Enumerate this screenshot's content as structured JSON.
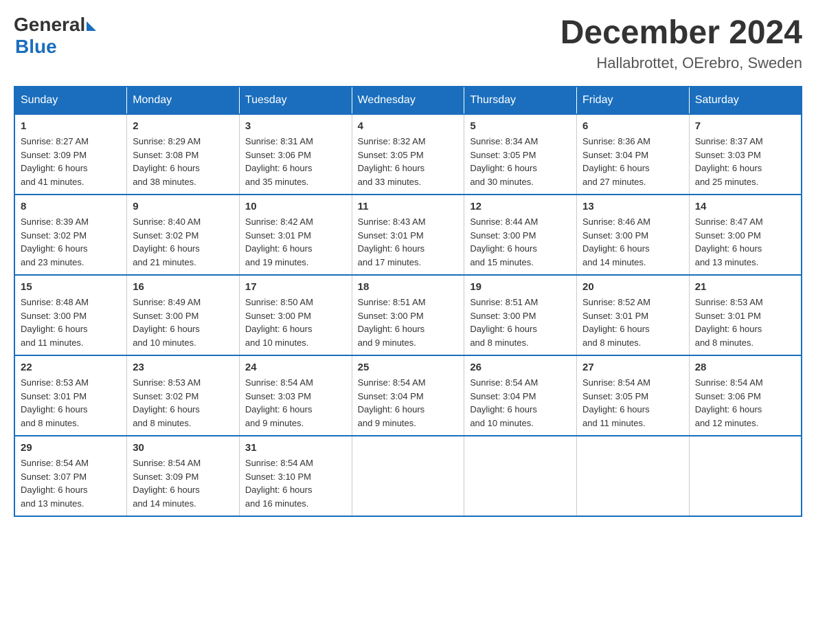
{
  "logo": {
    "general": "General",
    "blue": "Blue"
  },
  "title": "December 2024",
  "subtitle": "Hallabrottet, OErebro, Sweden",
  "days_header": [
    "Sunday",
    "Monday",
    "Tuesday",
    "Wednesday",
    "Thursday",
    "Friday",
    "Saturday"
  ],
  "weeks": [
    [
      {
        "day": "1",
        "sunrise": "8:27 AM",
        "sunset": "3:09 PM",
        "daylight": "6 hours and 41 minutes."
      },
      {
        "day": "2",
        "sunrise": "8:29 AM",
        "sunset": "3:08 PM",
        "daylight": "6 hours and 38 minutes."
      },
      {
        "day": "3",
        "sunrise": "8:31 AM",
        "sunset": "3:06 PM",
        "daylight": "6 hours and 35 minutes."
      },
      {
        "day": "4",
        "sunrise": "8:32 AM",
        "sunset": "3:05 PM",
        "daylight": "6 hours and 33 minutes."
      },
      {
        "day": "5",
        "sunrise": "8:34 AM",
        "sunset": "3:05 PM",
        "daylight": "6 hours and 30 minutes."
      },
      {
        "day": "6",
        "sunrise": "8:36 AM",
        "sunset": "3:04 PM",
        "daylight": "6 hours and 27 minutes."
      },
      {
        "day": "7",
        "sunrise": "8:37 AM",
        "sunset": "3:03 PM",
        "daylight": "6 hours and 25 minutes."
      }
    ],
    [
      {
        "day": "8",
        "sunrise": "8:39 AM",
        "sunset": "3:02 PM",
        "daylight": "6 hours and 23 minutes."
      },
      {
        "day": "9",
        "sunrise": "8:40 AM",
        "sunset": "3:02 PM",
        "daylight": "6 hours and 21 minutes."
      },
      {
        "day": "10",
        "sunrise": "8:42 AM",
        "sunset": "3:01 PM",
        "daylight": "6 hours and 19 minutes."
      },
      {
        "day": "11",
        "sunrise": "8:43 AM",
        "sunset": "3:01 PM",
        "daylight": "6 hours and 17 minutes."
      },
      {
        "day": "12",
        "sunrise": "8:44 AM",
        "sunset": "3:00 PM",
        "daylight": "6 hours and 15 minutes."
      },
      {
        "day": "13",
        "sunrise": "8:46 AM",
        "sunset": "3:00 PM",
        "daylight": "6 hours and 14 minutes."
      },
      {
        "day": "14",
        "sunrise": "8:47 AM",
        "sunset": "3:00 PM",
        "daylight": "6 hours and 13 minutes."
      }
    ],
    [
      {
        "day": "15",
        "sunrise": "8:48 AM",
        "sunset": "3:00 PM",
        "daylight": "6 hours and 11 minutes."
      },
      {
        "day": "16",
        "sunrise": "8:49 AM",
        "sunset": "3:00 PM",
        "daylight": "6 hours and 10 minutes."
      },
      {
        "day": "17",
        "sunrise": "8:50 AM",
        "sunset": "3:00 PM",
        "daylight": "6 hours and 10 minutes."
      },
      {
        "day": "18",
        "sunrise": "8:51 AM",
        "sunset": "3:00 PM",
        "daylight": "6 hours and 9 minutes."
      },
      {
        "day": "19",
        "sunrise": "8:51 AM",
        "sunset": "3:00 PM",
        "daylight": "6 hours and 8 minutes."
      },
      {
        "day": "20",
        "sunrise": "8:52 AM",
        "sunset": "3:01 PM",
        "daylight": "6 hours and 8 minutes."
      },
      {
        "day": "21",
        "sunrise": "8:53 AM",
        "sunset": "3:01 PM",
        "daylight": "6 hours and 8 minutes."
      }
    ],
    [
      {
        "day": "22",
        "sunrise": "8:53 AM",
        "sunset": "3:01 PM",
        "daylight": "6 hours and 8 minutes."
      },
      {
        "day": "23",
        "sunrise": "8:53 AM",
        "sunset": "3:02 PM",
        "daylight": "6 hours and 8 minutes."
      },
      {
        "day": "24",
        "sunrise": "8:54 AM",
        "sunset": "3:03 PM",
        "daylight": "6 hours and 9 minutes."
      },
      {
        "day": "25",
        "sunrise": "8:54 AM",
        "sunset": "3:04 PM",
        "daylight": "6 hours and 9 minutes."
      },
      {
        "day": "26",
        "sunrise": "8:54 AM",
        "sunset": "3:04 PM",
        "daylight": "6 hours and 10 minutes."
      },
      {
        "day": "27",
        "sunrise": "8:54 AM",
        "sunset": "3:05 PM",
        "daylight": "6 hours and 11 minutes."
      },
      {
        "day": "28",
        "sunrise": "8:54 AM",
        "sunset": "3:06 PM",
        "daylight": "6 hours and 12 minutes."
      }
    ],
    [
      {
        "day": "29",
        "sunrise": "8:54 AM",
        "sunset": "3:07 PM",
        "daylight": "6 hours and 13 minutes."
      },
      {
        "day": "30",
        "sunrise": "8:54 AM",
        "sunset": "3:09 PM",
        "daylight": "6 hours and 14 minutes."
      },
      {
        "day": "31",
        "sunrise": "8:54 AM",
        "sunset": "3:10 PM",
        "daylight": "6 hours and 16 minutes."
      },
      null,
      null,
      null,
      null
    ]
  ],
  "sunrise_label": "Sunrise:",
  "sunset_label": "Sunset:",
  "daylight_label": "Daylight:"
}
